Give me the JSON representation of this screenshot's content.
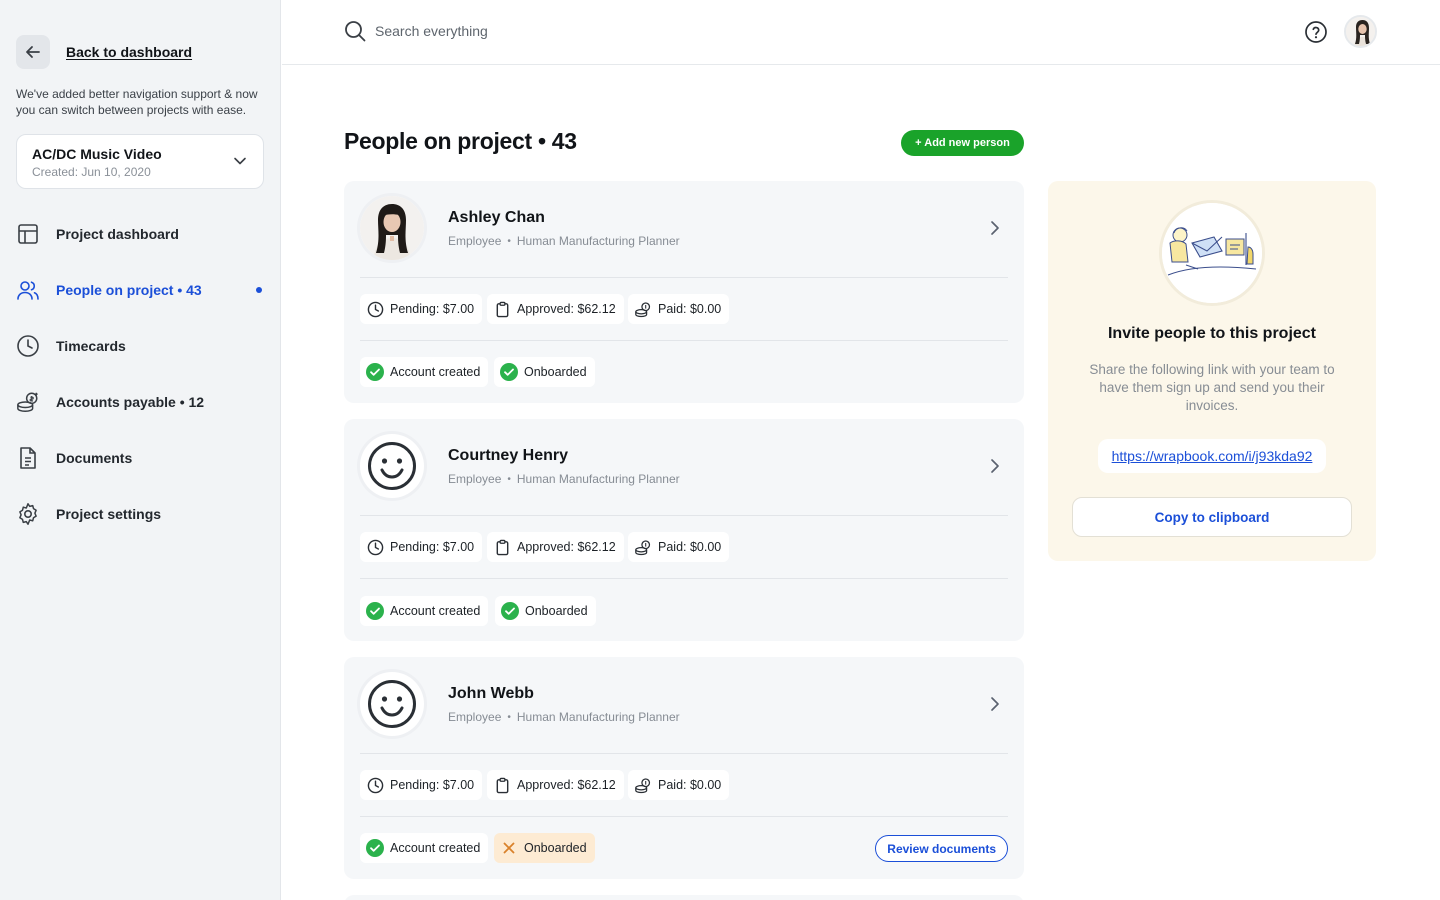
{
  "sidebar": {
    "back_label": "Back to dashboard",
    "notice": "We've added better navigation support & now you can switch between projects with ease.",
    "project": {
      "name": "AC/DC Music Video",
      "created": "Created: Jun 10, 2020"
    },
    "nav": [
      {
        "label": "Project dashboard",
        "icon": "layout-icon",
        "active": false
      },
      {
        "label": "People on project • 43",
        "icon": "users-icon",
        "active": true
      },
      {
        "label": "Timecards",
        "icon": "clock-icon",
        "active": false
      },
      {
        "label": "Accounts payable • 12",
        "icon": "coins-icon",
        "active": false
      },
      {
        "label": "Documents",
        "icon": "document-icon",
        "active": false
      },
      {
        "label": "Project settings",
        "icon": "gear-icon",
        "active": false
      }
    ]
  },
  "topbar": {
    "search_placeholder": "Search everything"
  },
  "main": {
    "title": "People on project • 43",
    "add_button": "+ Add new person",
    "people": [
      {
        "name": "Ashley Chan",
        "type": "Employee",
        "role": "Human Manufacturing Planner",
        "avatar": "photo",
        "pending": "Pending: $7.00",
        "approved": "Approved: $62.12",
        "paid": "Paid: $0.00",
        "account": "Account created",
        "onboarded": "Onboarded",
        "onboarded_ok": true
      },
      {
        "name": "Courtney Henry",
        "type": "Employee",
        "role": "Human Manufacturing Planner",
        "avatar": "smiley",
        "pending": "Pending: $7.00",
        "approved": "Approved: $62.12",
        "paid": "Paid: $0.00",
        "account": "Account created",
        "onboarded": "Onboarded",
        "onboarded_ok": true
      },
      {
        "name": "John Webb",
        "type": "Employee",
        "role": "Human Manufacturing Planner",
        "avatar": "smiley",
        "pending": "Pending: $7.00",
        "approved": "Approved: $62.12",
        "paid": "Paid: $0.00",
        "account": "Account created",
        "onboarded": "Onboarded",
        "onboarded_ok": false,
        "review_label": "Review documents"
      }
    ]
  },
  "invite": {
    "title": "Invite people to this project",
    "description": "Share the following link with your team to have them sign up and send you their invoices.",
    "link": "https://wrapbook.com/i/j93kda92",
    "copy_label": "Copy to clipboard"
  },
  "colors": {
    "accent": "#1b4fd8",
    "success": "#1aa32a",
    "check": "#2bb24c",
    "warn_bg": "#fdebd3",
    "invite_bg": "#fcf7ea"
  }
}
